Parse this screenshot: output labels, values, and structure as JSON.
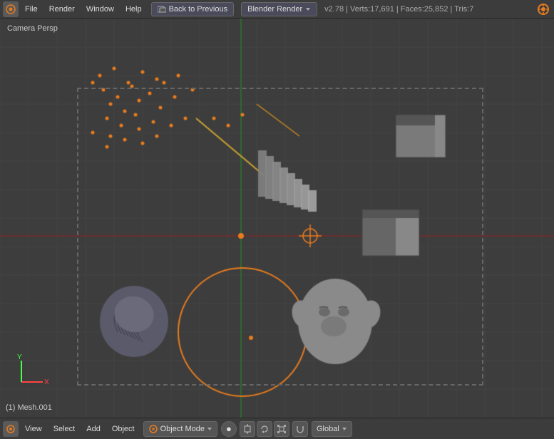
{
  "topbar": {
    "blender_icon": "⬡",
    "menus": [
      "File",
      "Render",
      "Window",
      "Help"
    ],
    "back_to_previous": "Back to Previous",
    "blender_render": "Blender Render",
    "stats": "v2.78 | Verts:17,691 | Faces:25,852 | Tris:7",
    "blender_version_icon": "⬡"
  },
  "viewport": {
    "camera_label": "Camera Persp",
    "background_color": "#3d3d3d"
  },
  "bottombar": {
    "icon": "⬡",
    "menus": [
      "View",
      "Select",
      "Add",
      "Object"
    ],
    "object_mode": "Object Mode",
    "global": "Global",
    "status_mesh": "(1) Mesh.001"
  }
}
